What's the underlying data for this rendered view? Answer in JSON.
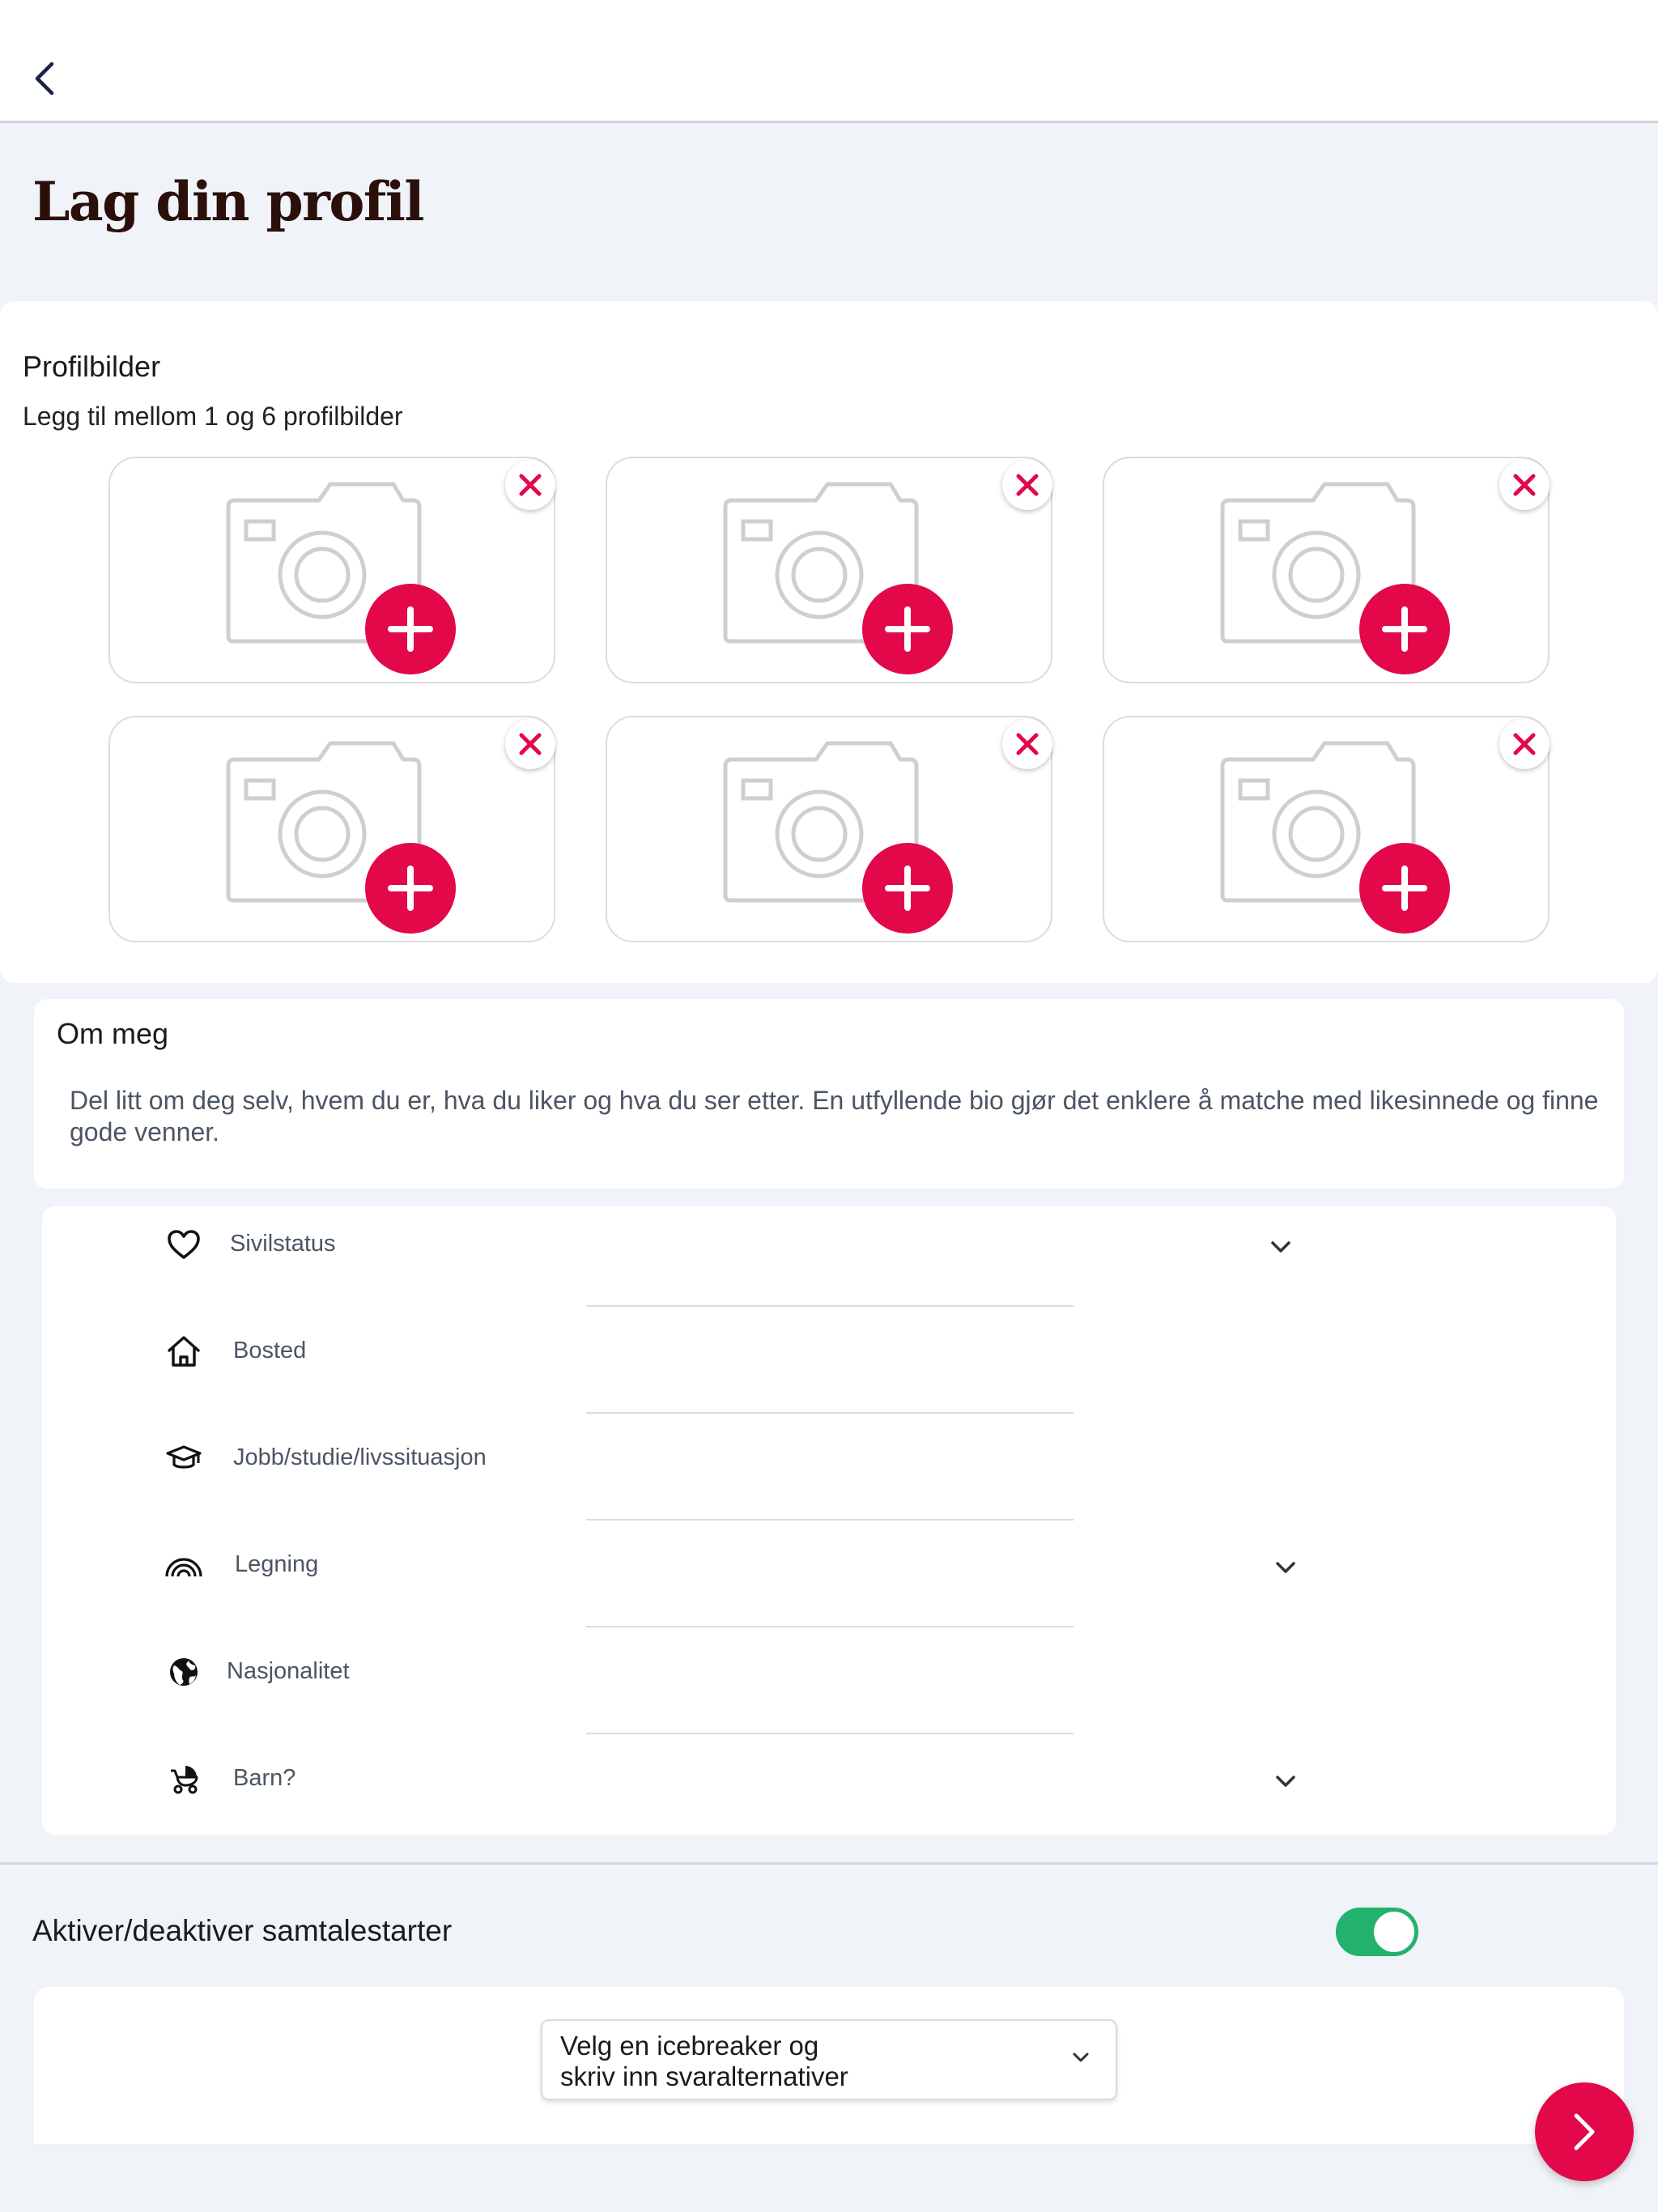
{
  "header": {
    "back_icon": "chevron-left-icon"
  },
  "page": {
    "title": "Lag din profil"
  },
  "photos": {
    "title": "Profilbilder",
    "subtitle": "Legg til mellom 1 og 6 profilbilder",
    "slot_count": 6
  },
  "about": {
    "title": "Om meg",
    "placeholder": "Del litt om deg selv, hvem du er, hva du liker og hva du ser etter. En utfyllende bio gjør det enklere å matche med likesinnede og finne gode venner."
  },
  "fields": [
    {
      "label": "Sivilstatus",
      "icon": "heart-icon",
      "dropdown": true
    },
    {
      "label": "Bosted",
      "icon": "home-icon",
      "dropdown": false
    },
    {
      "label": "Jobb/studie/livssituasjon",
      "icon": "graduation-cap-icon",
      "dropdown": false
    },
    {
      "label": "Legning",
      "icon": "rainbow-icon",
      "dropdown": true
    },
    {
      "label": "Nasjonalitet",
      "icon": "globe-icon",
      "dropdown": false
    },
    {
      "label": "Barn?",
      "icon": "stroller-icon",
      "dropdown": true
    }
  ],
  "icebreaker": {
    "toggle_label": "Aktiver/deaktiver samtalestarter",
    "toggle_on": true,
    "select_line1": "Velg en icebreaker og",
    "select_line2": "skriv inn svaralternativer"
  },
  "colors": {
    "accent": "#e2084a",
    "toggle_on": "#23b26d",
    "background": "#f0f3f8"
  }
}
